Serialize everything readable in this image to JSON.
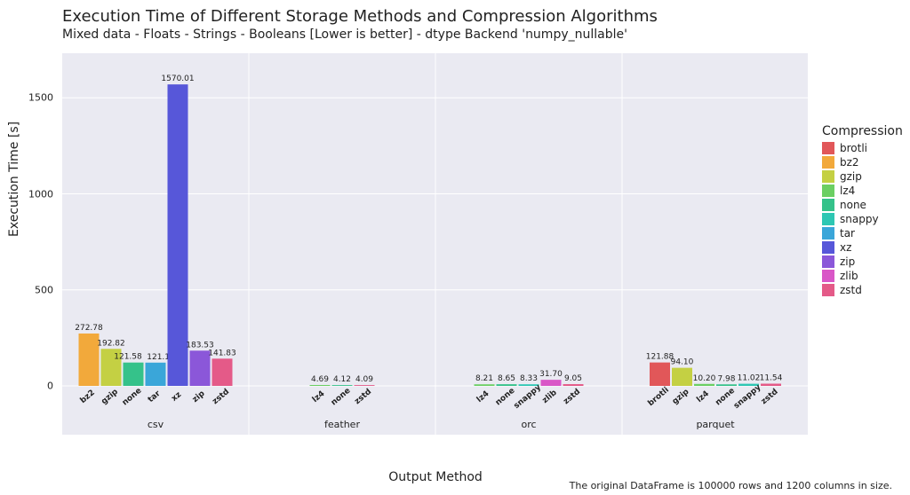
{
  "text": {
    "title": "Execution Time of Different Storage Methods and Compression Algorithms",
    "subtitle": "Mixed data - Floats - Strings - Booleans [Lower is better] - dtype Backend 'numpy_nullable'",
    "ylabel": "Execution Time [s]",
    "xlabel": "Output Method",
    "footnote": "The original DataFrame is 100000 rows and 1200 columns in size.",
    "legend_title": "Compression"
  },
  "legend": [
    {
      "name": "brotli",
      "color": "#e15759"
    },
    {
      "name": "bz2",
      "color": "#f2a93b"
    },
    {
      "name": "gzip",
      "color": "#c4d043"
    },
    {
      "name": "lz4",
      "color": "#6bcf63"
    },
    {
      "name": "none",
      "color": "#35c28a"
    },
    {
      "name": "snappy",
      "color": "#2ec7b3"
    },
    {
      "name": "tar",
      "color": "#3aa6d9"
    },
    {
      "name": "xz",
      "color": "#5757d9"
    },
    {
      "name": "zip",
      "color": "#8b57d9"
    },
    {
      "name": "zlib",
      "color": "#d957c7"
    },
    {
      "name": "zstd",
      "color": "#e45a88"
    }
  ],
  "chart_data": {
    "type": "bar",
    "ylabel": "Execution Time [s]",
    "xlabel": "Output Method",
    "title": "Execution Time of Different Storage Methods and Compression Algorithms",
    "ylim": [
      0,
      1640
    ],
    "yticks": [
      0,
      500,
      1000,
      1500
    ],
    "groups": [
      {
        "name": "csv",
        "bars": [
          {
            "cat": "bz2",
            "value": 272.78,
            "color": "#f2a93b"
          },
          {
            "cat": "gzip",
            "value": 192.82,
            "color": "#c4d043"
          },
          {
            "cat": "none",
            "value": 121.58,
            "color": "#35c28a",
            "labelShift": -6
          },
          {
            "cat": "tar",
            "value": 121.12,
            "color": "#3aa6d9",
            "labelShift": 6
          },
          {
            "cat": "xz",
            "value": 1570.01,
            "color": "#5757d9"
          },
          {
            "cat": "zip",
            "value": 183.53,
            "color": "#8b57d9"
          },
          {
            "cat": "zstd",
            "value": 141.83,
            "color": "#e45a88"
          }
        ]
      },
      {
        "name": "feather",
        "bars": [
          {
            "cat": "lz4",
            "value": 4.69,
            "color": "#6bcf63"
          },
          {
            "cat": "none",
            "value": 4.12,
            "color": "#35c28a"
          },
          {
            "cat": "zstd",
            "value": 4.09,
            "color": "#e45a88"
          }
        ]
      },
      {
        "name": "orc",
        "bars": [
          {
            "cat": "lz4",
            "value": 8.21,
            "color": "#6bcf63"
          },
          {
            "cat": "none",
            "value": 8.65,
            "color": "#35c28a"
          },
          {
            "cat": "snappy",
            "value": 8.33,
            "color": "#2ec7b3"
          },
          {
            "cat": "zlib",
            "value": 31.7,
            "color": "#d957c7"
          },
          {
            "cat": "zstd",
            "value": 9.05,
            "color": "#e45a88"
          }
        ]
      },
      {
        "name": "parquet",
        "bars": [
          {
            "cat": "brotli",
            "value": 121.88,
            "color": "#e15759"
          },
          {
            "cat": "gzip",
            "value": 94.1,
            "color": "#c4d043"
          },
          {
            "cat": "lz4",
            "value": 10.2,
            "color": "#6bcf63"
          },
          {
            "cat": "none",
            "value": 7.98,
            "color": "#35c28a"
          },
          {
            "cat": "snappy",
            "value": 11.02,
            "color": "#2ec7b3"
          },
          {
            "cat": "zstd",
            "value": 11.54,
            "color": "#e45a88"
          }
        ]
      }
    ]
  }
}
